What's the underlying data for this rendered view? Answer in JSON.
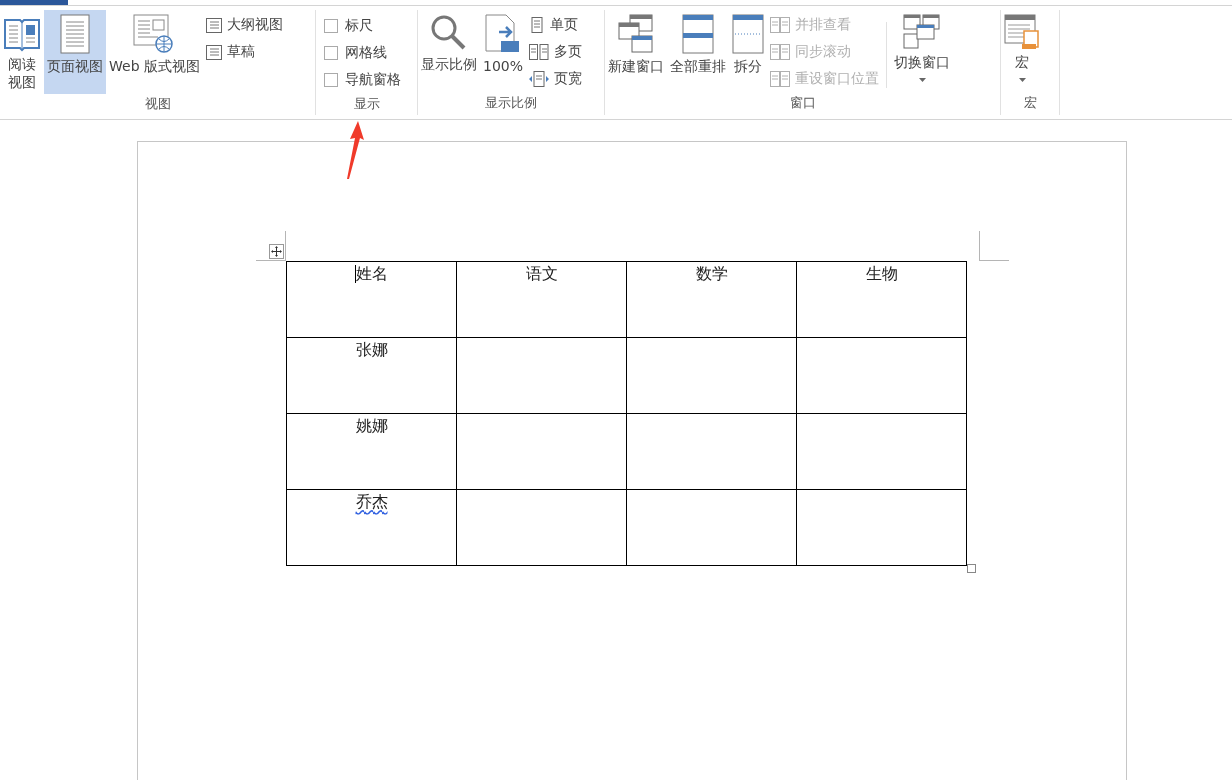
{
  "ribbon": {
    "view_group": {
      "label": "视图",
      "large_buttons": [
        {
          "label": "阅读视图",
          "selected": false
        },
        {
          "label": "页面视图",
          "selected": true
        },
        {
          "label": "Web 版式视图",
          "selected": false
        }
      ],
      "small_buttons": [
        {
          "label": "大纲视图",
          "selected": false
        },
        {
          "label": "草稿",
          "selected": false
        }
      ]
    },
    "show_group": {
      "label": "显示",
      "checkboxes": [
        {
          "label": "标尺",
          "checked": false
        },
        {
          "label": "网格线",
          "checked": false
        },
        {
          "label": "导航窗格",
          "checked": false
        }
      ]
    },
    "zoom_group": {
      "label": "显示比例",
      "large_buttons": [
        {
          "label": "显示比例"
        },
        {
          "label": "100%"
        }
      ],
      "small_buttons": [
        {
          "label": "单页"
        },
        {
          "label": "多页"
        },
        {
          "label": "页宽"
        }
      ]
    },
    "window_group": {
      "label": "窗口",
      "large_buttons": [
        {
          "label": "新建窗口"
        },
        {
          "label": "全部重排"
        },
        {
          "label": "拆分"
        }
      ],
      "small_buttons": [
        {
          "label": "并排查看",
          "disabled": true
        },
        {
          "label": "同步滚动",
          "disabled": true
        },
        {
          "label": "重设窗口位置",
          "disabled": true
        }
      ],
      "switch_button": {
        "label": "切换窗口"
      }
    },
    "macro_group": {
      "label": "宏",
      "button": {
        "label": "宏"
      }
    }
  },
  "table": {
    "columns": [
      "姓名",
      "语文",
      "数学",
      "生物"
    ],
    "rows": [
      {
        "name": "张娜",
        "misspelled": false
      },
      {
        "name": "姚娜",
        "misspelled": false
      },
      {
        "name": "乔杰",
        "misspelled": true
      }
    ]
  }
}
